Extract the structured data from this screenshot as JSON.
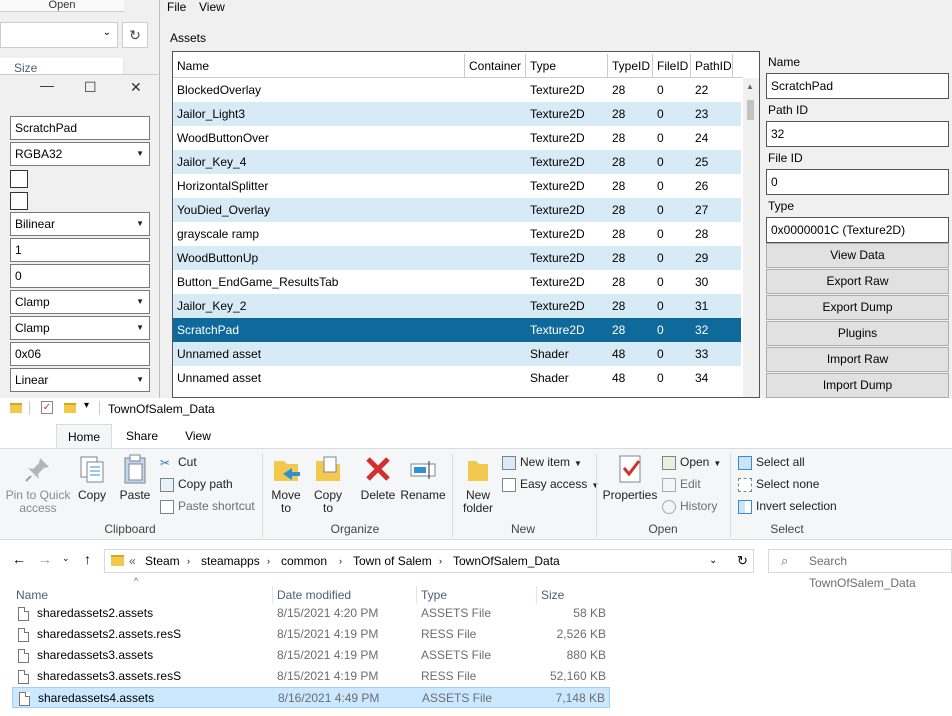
{
  "bg_window": {
    "header": "Open",
    "refresh_glyph": "↻",
    "size_col": "Size"
  },
  "texture_dialog": {
    "minimize": "—",
    "maximize": "☐",
    "close": "✕",
    "name_value": "ScratchPad",
    "format_value": "RGBA32",
    "filter_value": "Bilinear",
    "aniso_value": "1",
    "mip_bias_value": "0",
    "wrap_u_value": "Clamp",
    "wrap_v_value": "Clamp",
    "flags_value": "0x06",
    "color_space_value": "Linear"
  },
  "asset_bundle": {
    "menu": {
      "file": "File",
      "view": "View"
    },
    "assets_label": "Assets",
    "columns": [
      "Name",
      "Container",
      "Type",
      "TypeID",
      "FileID",
      "PathID"
    ],
    "rows": [
      {
        "name": "BlockedOverlay",
        "container": "",
        "type": "Texture2D",
        "typeid": "28",
        "fileid": "0",
        "pathid": "22"
      },
      {
        "name": "Jailor_Light3",
        "container": "",
        "type": "Texture2D",
        "typeid": "28",
        "fileid": "0",
        "pathid": "23"
      },
      {
        "name": "WoodButtonOver",
        "container": "",
        "type": "Texture2D",
        "typeid": "28",
        "fileid": "0",
        "pathid": "24"
      },
      {
        "name": "Jailor_Key_4",
        "container": "",
        "type": "Texture2D",
        "typeid": "28",
        "fileid": "0",
        "pathid": "25"
      },
      {
        "name": "HorizontalSplitter",
        "container": "",
        "type": "Texture2D",
        "typeid": "28",
        "fileid": "0",
        "pathid": "26"
      },
      {
        "name": "YouDied_Overlay",
        "container": "",
        "type": "Texture2D",
        "typeid": "28",
        "fileid": "0",
        "pathid": "27"
      },
      {
        "name": "grayscale ramp",
        "container": "",
        "type": "Texture2D",
        "typeid": "28",
        "fileid": "0",
        "pathid": "28"
      },
      {
        "name": "WoodButtonUp",
        "container": "",
        "type": "Texture2D",
        "typeid": "28",
        "fileid": "0",
        "pathid": "29"
      },
      {
        "name": "Button_EndGame_ResultsTab",
        "container": "",
        "type": "Texture2D",
        "typeid": "28",
        "fileid": "0",
        "pathid": "30"
      },
      {
        "name": "Jailor_Key_2",
        "container": "",
        "type": "Texture2D",
        "typeid": "28",
        "fileid": "0",
        "pathid": "31"
      },
      {
        "name": "ScratchPad",
        "container": "",
        "type": "Texture2D",
        "typeid": "28",
        "fileid": "0",
        "pathid": "32"
      },
      {
        "name": "Unnamed asset",
        "container": "",
        "type": "Shader",
        "typeid": "48",
        "fileid": "0",
        "pathid": "33"
      },
      {
        "name": "Unnamed asset",
        "container": "",
        "type": "Shader",
        "typeid": "48",
        "fileid": "0",
        "pathid": "34"
      }
    ],
    "selected_row": 10,
    "props": {
      "name_label": "Name",
      "name_value": "ScratchPad",
      "pathid_label": "Path ID",
      "pathid_value": "32",
      "fileid_label": "File ID",
      "fileid_value": "0",
      "type_label": "Type",
      "type_value": "0x0000001C (Texture2D)"
    },
    "buttons": [
      "View Data",
      "Export Raw",
      "Export Dump",
      "Plugins",
      "Import Raw",
      "Import Dump"
    ]
  },
  "explorer": {
    "title": "TownOfSalem_Data",
    "tabs": [
      "Home",
      "Share",
      "View"
    ],
    "clipboard": {
      "pin": "Pin to Quick access",
      "copy": "Copy",
      "paste": "Paste",
      "cut": "Cut",
      "copy_path": "Copy path",
      "paste_shortcut": "Paste shortcut",
      "group": "Clipboard"
    },
    "organize": {
      "move_to": "Move to",
      "copy_to": "Copy to",
      "delete": "Delete",
      "rename": "Rename",
      "group": "Organize"
    },
    "new": {
      "new_folder": "New folder",
      "new_item": "New item",
      "easy_access": "Easy access",
      "group": "New"
    },
    "open": {
      "properties": "Properties",
      "open": "Open",
      "edit": "Edit",
      "history": "History",
      "group": "Open"
    },
    "select": {
      "select_all": "Select all",
      "select_none": "Select none",
      "invert": "Invert selection",
      "group": "Select"
    },
    "address": {
      "crumbs": [
        "Steam",
        "steamapps",
        "common",
        "Town of Salem",
        "TownOfSalem_Data"
      ]
    },
    "search_placeholder": "Search TownOfSalem_Data",
    "columns": {
      "name": "Name",
      "date": "Date modified",
      "type": "Type",
      "size": "Size"
    },
    "files": [
      {
        "name": "sharedassets2.assets",
        "date": "8/15/2021 4:20 PM",
        "type": "ASSETS File",
        "size": "58 KB"
      },
      {
        "name": "sharedassets2.assets.resS",
        "date": "8/15/2021 4:19 PM",
        "type": "RESS File",
        "size": "2,526 KB"
      },
      {
        "name": "sharedassets3.assets",
        "date": "8/15/2021 4:19 PM",
        "type": "ASSETS File",
        "size": "880 KB"
      },
      {
        "name": "sharedassets3.assets.resS",
        "date": "8/15/2021 4:19 PM",
        "type": "RESS File",
        "size": "52,160 KB"
      },
      {
        "name": "sharedassets4.assets",
        "date": "8/16/2021 4:49 PM",
        "type": "ASSETS File",
        "size": "7,148 KB"
      }
    ],
    "selected_file": 4
  }
}
